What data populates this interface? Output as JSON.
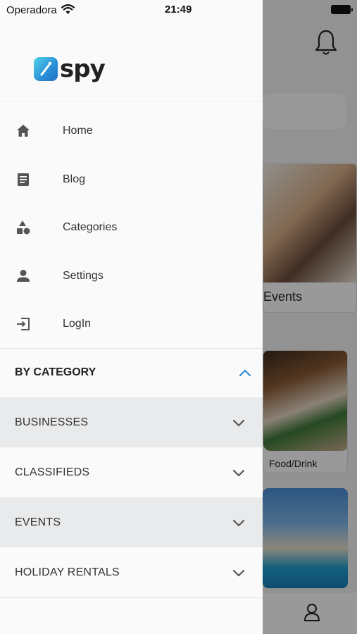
{
  "status_bar": {
    "carrier": "Operadora",
    "time": "21:49"
  },
  "brand": {
    "logo_text": "spy",
    "accent": "#2a8fd8"
  },
  "menu": {
    "items": [
      {
        "label": "Home",
        "icon": "home-icon"
      },
      {
        "label": "Blog",
        "icon": "blog-icon"
      },
      {
        "label": "Categories",
        "icon": "categories-icon"
      },
      {
        "label": "Settings",
        "icon": "person-icon"
      },
      {
        "label": "LogIn",
        "icon": "login-icon"
      }
    ]
  },
  "by_category": {
    "title": "BY CATEGORY",
    "expanded": true,
    "items": [
      {
        "label": "BUSINESSES"
      },
      {
        "label": "CLASSIFIEDS"
      },
      {
        "label": "EVENTS"
      },
      {
        "label": "HOLIDAY RENTALS"
      }
    ]
  },
  "background": {
    "cards": [
      {
        "caption": "Events"
      },
      {
        "caption": "Food/Drink"
      }
    ]
  }
}
